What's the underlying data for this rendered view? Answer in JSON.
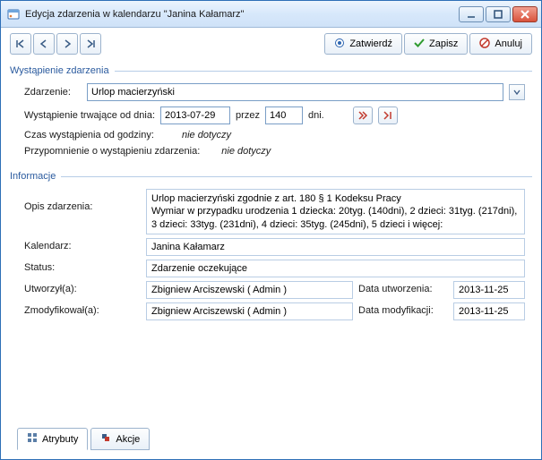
{
  "window": {
    "title": "Edycja zdarzenia w kalendarzu \"Janina Kałamarz\""
  },
  "toolbar": {
    "confirm": "Zatwierdź",
    "save": "Zapisz",
    "cancel": "Anuluj"
  },
  "section_occurrence": {
    "title": "Wystąpienie zdarzenia",
    "event_label": "Zdarzenie:",
    "event_value": "Urlop macierzyński",
    "from_label": "Wystąpienie trwające od dnia:",
    "from_value": "2013-07-29",
    "through_label": "przez",
    "days_value": "140",
    "days_unit": "dni.",
    "time_label": "Czas wystąpienia od godziny:",
    "time_value": "nie dotyczy",
    "reminder_label": "Przypomnienie o wystąpieniu zdarzenia:",
    "reminder_value": "nie dotyczy"
  },
  "section_info": {
    "title": "Informacje",
    "desc_label": "Opis zdarzenia:",
    "desc_value": "Urlop macierzyński zgodnie z art. 180 § 1 Kodeksu Pracy\nWymiar w przypadku urodzenia 1 dziecka: 20tyg. (140dni), 2 dzieci: 31tyg. (217dni), 3 dzieci: 33tyg. (231dni), 4 dzieci: 35tyg. (245dni), 5 dzieci i więcej:",
    "calendar_label": "Kalendarz:",
    "calendar_value": "Janina Kałamarz",
    "status_label": "Status:",
    "status_value": "Zdarzenie oczekujące",
    "created_by_label": "Utworzył(a):",
    "created_by_value": "Zbigniew Arciszewski ( Admin )",
    "created_date_label": "Data utworzenia:",
    "created_date_value": "2013-11-25",
    "modified_by_label": "Zmodyfikował(a):",
    "modified_by_value": "Zbigniew Arciszewski ( Admin )",
    "modified_date_label": "Data modyfikacji:",
    "modified_date_value": "2013-11-25"
  },
  "tabs": {
    "attributes": "Atrybuty",
    "actions": "Akcje"
  }
}
